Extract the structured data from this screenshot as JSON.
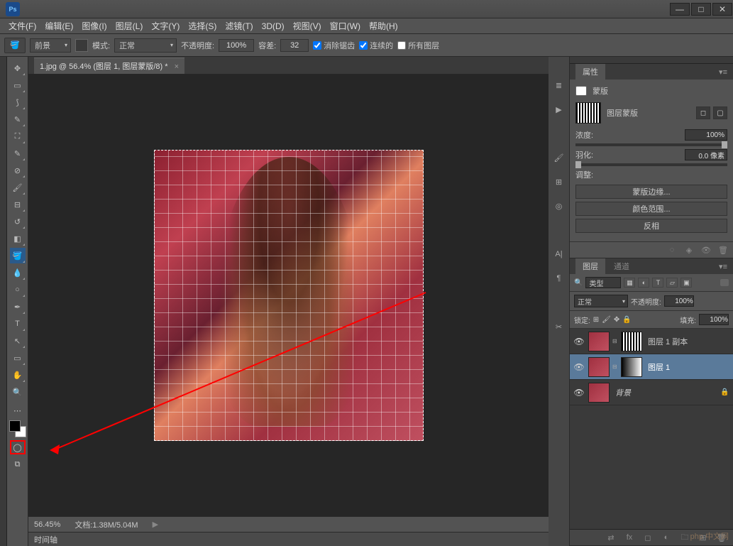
{
  "window": {
    "minimize": "—",
    "maximize": "□",
    "close": "✕"
  },
  "app": {
    "logo": "Ps"
  },
  "menu": {
    "file": "文件(F)",
    "edit": "编辑(E)",
    "image": "图像(I)",
    "layer": "图层(L)",
    "type": "文字(Y)",
    "select": "选择(S)",
    "filter": "滤镜(T)",
    "threed": "3D(D)",
    "view": "视图(V)",
    "window": "窗口(W)",
    "help": "帮助(H)"
  },
  "options": {
    "fill_dd": "前景",
    "mode_label": "模式:",
    "mode_dd": "正常",
    "opacity_label": "不透明度:",
    "opacity_val": "100%",
    "tolerance_label": "容差:",
    "tolerance_val": "32",
    "antialias": "消除锯齿",
    "contiguous": "连续的",
    "all_layers": "所有图层"
  },
  "document": {
    "tab_title": "1.jpg @ 56.4% (图层 1, 图层蒙版/8) *"
  },
  "status": {
    "zoom": "56.45%",
    "doc_info": "文档:1.38M/5.04M",
    "timeline": "时间轴"
  },
  "properties": {
    "panel_title": "属性",
    "mask_label": "蒙版",
    "mask_type": "图层蒙版",
    "density_label": "浓度:",
    "density_val": "100%",
    "feather_label": "羽化:",
    "feather_val": "0.0 像素",
    "adjust_label": "调整:",
    "btn_edge": "蒙版边缘...",
    "btn_range": "颜色范围...",
    "btn_invert": "反相"
  },
  "layers_panel": {
    "tab_layers": "图层",
    "tab_channels": "通道",
    "kind_label": "类型",
    "blend_mode": "正常",
    "opacity_label": "不透明度:",
    "opacity_val": "100%",
    "lock_label": "锁定:",
    "fill_label": "填充:",
    "fill_val": "100%",
    "rows": [
      {
        "name": "图层 1 副本"
      },
      {
        "name": "图层 1"
      },
      {
        "name": "背景"
      }
    ]
  },
  "watermark": "php 中文网"
}
